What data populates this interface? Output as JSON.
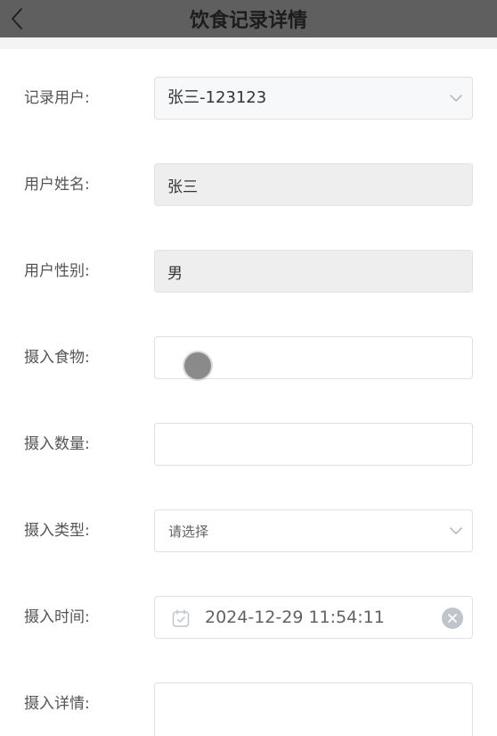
{
  "header": {
    "title": "饮食记录详情",
    "back_icon": "chevron-left-icon"
  },
  "form": {
    "record_user": {
      "label": "记录用户:",
      "value": "张三-123123",
      "icon": "chevron-down-icon"
    },
    "user_name": {
      "label": "用户姓名:",
      "value": "张三"
    },
    "user_gender": {
      "label": "用户性别:",
      "value": "男"
    },
    "food": {
      "label": "摄入食物:",
      "value": ""
    },
    "quantity": {
      "label": "摄入数量:",
      "value": ""
    },
    "intake_type": {
      "label": "摄入类型:",
      "placeholder": "请选择",
      "icon": "chevron-down-icon"
    },
    "intake_time": {
      "label": "摄入时间:",
      "value": "2024-12-29 11:54:11",
      "prefix_icon": "calendar-icon",
      "clear_icon": "clear-circle-icon"
    },
    "details": {
      "label": "摄入详情:",
      "value": ""
    }
  },
  "colors": {
    "header_bg": "#5f5f5f",
    "disabled_bg": "#eeeeee",
    "border": "#dcdfe6",
    "muted_text": "#606266",
    "icon": "#c0c4cc"
  }
}
